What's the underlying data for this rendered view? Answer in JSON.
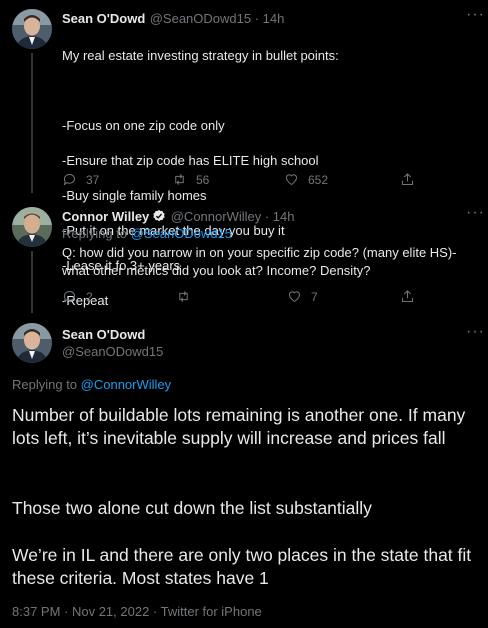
{
  "tweet1": {
    "name": "Sean O'Dowd",
    "handle_time": "@SeanODowd15 · 14h",
    "lines": [
      "My real estate investing strategy in bullet points:",
      "",
      "-Focus on one zip code only",
      "-Ensure that zip code has ELITE high school",
      "-Buy single family homes",
      "-Put it on the market the day you buy it",
      "-Lease it fo 3+ years",
      "-Repeat"
    ],
    "replies": "37",
    "retweets": "56",
    "likes": "652"
  },
  "tweet2": {
    "name": "Connor Willey",
    "handle_time": "@ConnorWilley · 14h",
    "replying_prefix": "Replying to ",
    "replying_handle": "@SeanODowd15",
    "text": "Q: how did you narrow in on your specific zip code? (many elite HS)- what other metrics did you look at? Income? Density?",
    "replies": "2",
    "retweets": "",
    "likes": "7"
  },
  "main": {
    "name": "Sean O'Dowd",
    "handle": "@SeanODowd15",
    "replying_prefix": "Replying to ",
    "replying_handle": "@ConnorWilley",
    "para1": "Number of buildable lots remaining is another one. If many lots left, it’s inevitable supply will increase and prices fall",
    "para2": "Those two alone cut down the list substantially",
    "para3": "We’re in IL and there are only two places in the state that fit these criteria. Most states have 1",
    "meta": "8:37 PM · Nov 21, 2022 · Twitter for iPhone"
  },
  "icons": {
    "more": "more-icon",
    "reply": "reply-icon",
    "retweet": "retweet-icon",
    "like": "heart-icon",
    "share": "share-icon",
    "verified": "verified-badge-icon"
  },
  "colors": {
    "background": "#000000",
    "text": "#e7e9ea",
    "secondary": "#71767b",
    "link": "#1d9bf0"
  }
}
